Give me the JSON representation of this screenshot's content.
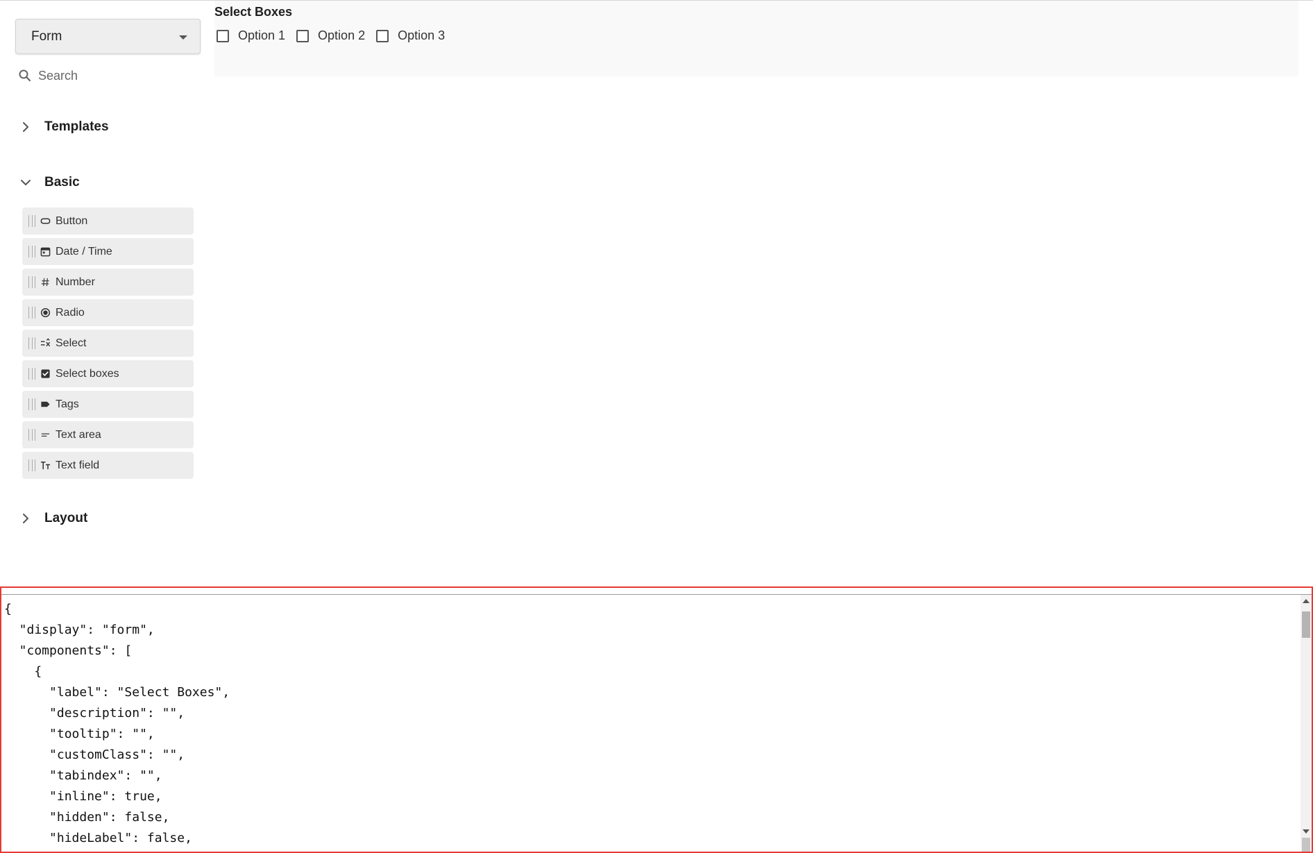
{
  "sidebar": {
    "display_select": {
      "value": "Form"
    },
    "search": {
      "placeholder": "Search",
      "value": ""
    },
    "groups": {
      "templates": {
        "title": "Templates",
        "expanded": false
      },
      "basic": {
        "title": "Basic",
        "expanded": true
      },
      "layout": {
        "title": "Layout",
        "expanded": false
      }
    },
    "basic_items": [
      {
        "label": "Button",
        "icon": "button-icon"
      },
      {
        "label": "Date / Time",
        "icon": "calendar-icon"
      },
      {
        "label": "Number",
        "icon": "hash-icon"
      },
      {
        "label": "Radio",
        "icon": "radio-icon"
      },
      {
        "label": "Select",
        "icon": "select-list-icon"
      },
      {
        "label": "Select boxes",
        "icon": "checkbox-checked-icon"
      },
      {
        "label": "Tags",
        "icon": "tag-icon"
      },
      {
        "label": "Text area",
        "icon": "text-area-icon"
      },
      {
        "label": "Text field",
        "icon": "text-field-icon"
      }
    ]
  },
  "canvas": {
    "component": {
      "label": "Select Boxes",
      "options": [
        {
          "label": "Option 1",
          "checked": false
        },
        {
          "label": "Option 2",
          "checked": false
        },
        {
          "label": "Option 3",
          "checked": false
        }
      ]
    }
  },
  "json_output": {
    "lines": [
      "{",
      "  \"display\": \"form\",",
      "  \"components\": [",
      "    {",
      "      \"label\": \"Select Boxes\",",
      "      \"description\": \"\",",
      "      \"tooltip\": \"\",",
      "      \"customClass\": \"\",",
      "      \"tabindex\": \"\",",
      "      \"inline\": true,",
      "      \"hidden\": false,",
      "      \"hideLabel\": false,"
    ]
  },
  "colors": {
    "accent_border": "#e53935",
    "palette_item_bg": "#ededed",
    "canvas_bg": "#f9f9f9"
  }
}
